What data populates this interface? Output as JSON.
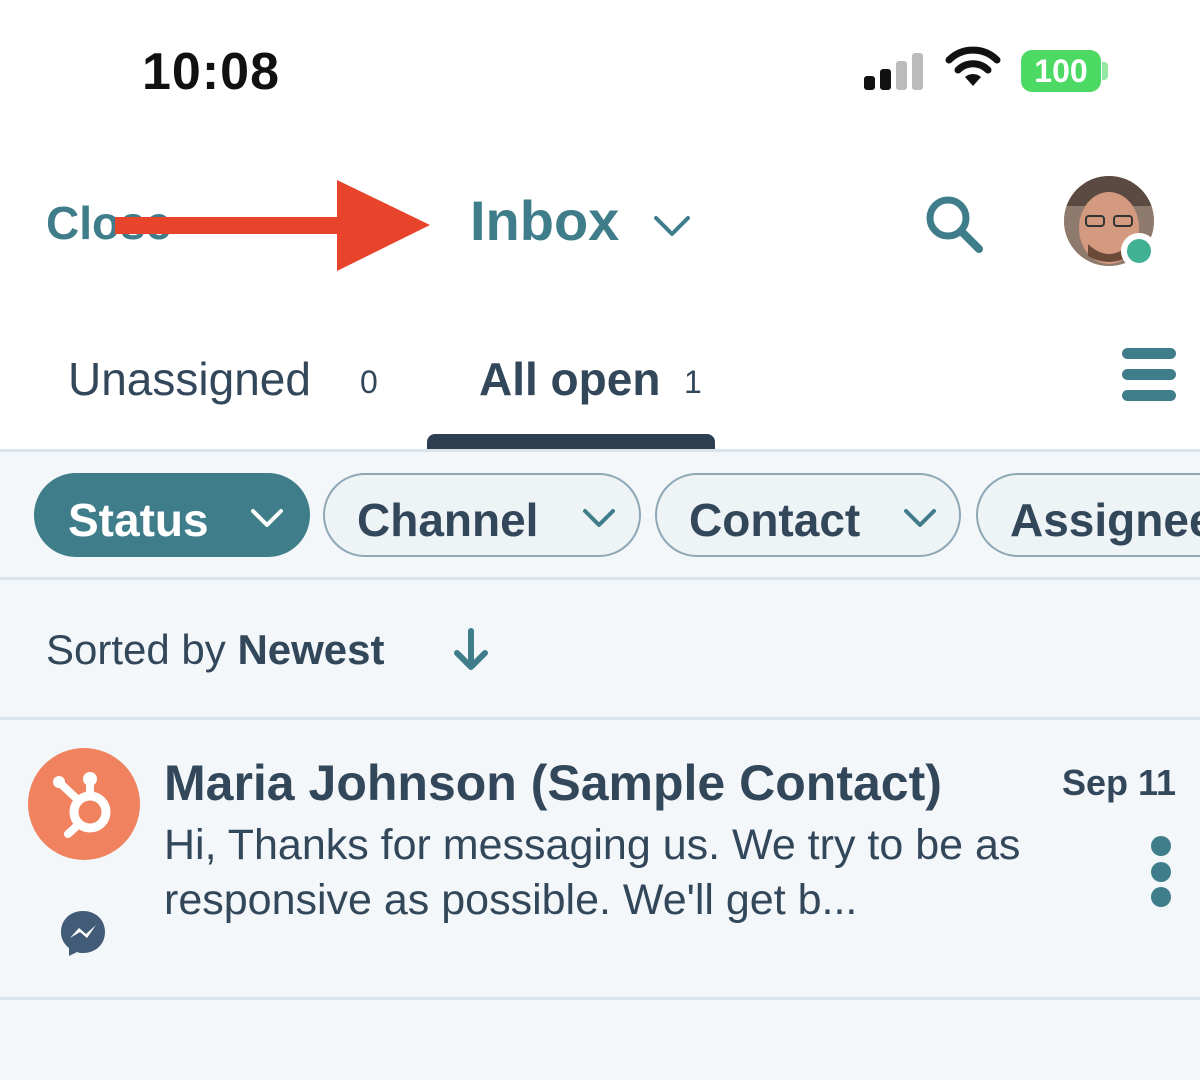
{
  "status_bar": {
    "time": "10:08",
    "battery": "100",
    "battery_color": "#4cd964"
  },
  "header": {
    "close_label": "Close",
    "title": "Inbox",
    "title_icon": "chevron-down-icon",
    "search_icon": "search-icon",
    "avatar_status": "online",
    "accent_color": "#3e7d89"
  },
  "annotation": {
    "arrow_color": "#e8432b"
  },
  "tabs": [
    {
      "label": "Unassigned",
      "count": "0"
    },
    {
      "label": "All open",
      "count": "1"
    }
  ],
  "filters": [
    {
      "label": "Status",
      "active": true
    },
    {
      "label": "Channel",
      "active": false
    },
    {
      "label": "Contact",
      "active": false
    },
    {
      "label": "Assignee",
      "active": false
    }
  ],
  "sort": {
    "prefix": "Sorted by",
    "value": "Newest"
  },
  "conversations": [
    {
      "name": "Maria Johnson (Sample Contact)",
      "date": "Sep 11",
      "preview": "Hi,  Thanks for messaging us. We try to be as responsive as possible. We'll get b...",
      "avatar_icon": "hubspot-sprocket-icon",
      "avatar_color": "#f0825f",
      "channel_icon": "messenger-icon"
    }
  ]
}
